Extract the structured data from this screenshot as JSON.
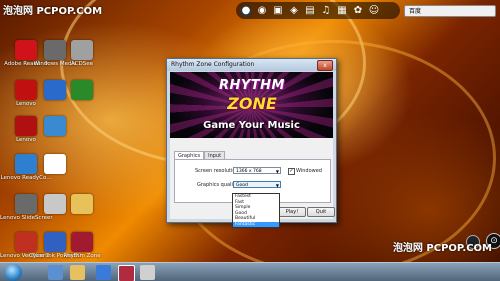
{
  "watermark_top": "泡泡网 PCPOP.COM",
  "watermark_bottom": "泡泡网 PCPOP.COM",
  "search": {
    "placeholder": "百度"
  },
  "desktop_icons": [
    {
      "label": "Adobe Reader 9",
      "color": "#d0121b"
    },
    {
      "label": "Windows Media",
      "color": "#6a6a6a"
    },
    {
      "label": "ACDSee",
      "color": "#a0a0a0"
    },
    {
      "label": "Lenovo",
      "color": "#c01010"
    },
    {
      "label": "Lenovo",
      "color": "#b01010"
    },
    {
      "label": "Lenovo ReadyCo...",
      "color": "#2f7fd0"
    },
    {
      "label": "Lenovo SlideScreen",
      "color": "#6a6a6a"
    },
    {
      "label": "Lenovo VeriFace 3.6",
      "color": "#c03020"
    },
    {
      "label": "Cyberlink Power2Go",
      "color": "#3060c0"
    },
    {
      "label": "CyberLink",
      "color": "#2a8a2a"
    },
    {
      "label": "Rhythm Zone",
      "color": "#a01a30"
    }
  ],
  "dialog": {
    "title": "Rhythm Zone Configuration",
    "close": "x",
    "logo_line1": "RHYTHM",
    "logo_line2": "ZONE",
    "tagline": "Game Your Music",
    "tab1": "Graphics",
    "tab2": "Input",
    "screen_resolution_label": "Screen resolution",
    "screen_resolution_value": "1366 x 768",
    "windowed_label": "Windowed",
    "windowed_checked": "✓",
    "graphics_quality_label": "Graphics quality",
    "graphics_quality_value": "Good",
    "quality_options": [
      "Fastest",
      "Fast",
      "Simple",
      "Good",
      "Beautiful",
      "Fantastic"
    ],
    "play_button": "Play!",
    "quit_button": "Quit"
  }
}
